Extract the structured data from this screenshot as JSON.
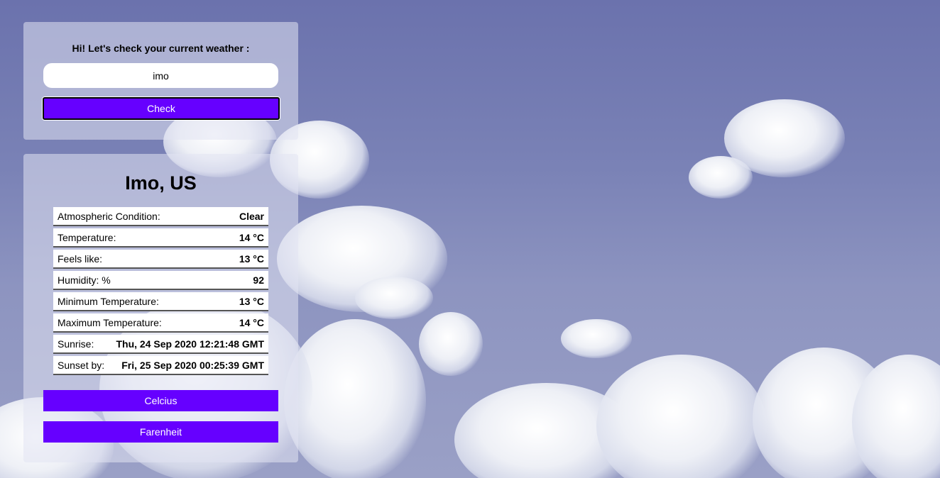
{
  "search": {
    "greeting": "Hi! Let's check your current weather :",
    "city_value": "imo",
    "check_label": "Check"
  },
  "result": {
    "location": "Imo, US",
    "rows": [
      {
        "label": "Atmospheric Condition:",
        "value": "Clear"
      },
      {
        "label": "Temperature:",
        "value": "14 °C"
      },
      {
        "label": "Feels like:",
        "value": "13 °C"
      },
      {
        "label": "Humidity: %",
        "value": "92"
      },
      {
        "label": "Minimum Temperature:",
        "value": "13 °C"
      },
      {
        "label": "Maximum Temperature:",
        "value": "14 °C"
      },
      {
        "label": "Sunrise:",
        "value": "Thu, 24 Sep 2020 12:21:48 GMT"
      },
      {
        "label": "Sunset by:",
        "value": "Fri, 25 Sep 2020 00:25:39 GMT"
      }
    ],
    "celsius_label": "Celcius",
    "fahrenheit_label": "Farenheit"
  },
  "colors": {
    "accent": "#6600ff",
    "sky": "#7179b0"
  }
}
